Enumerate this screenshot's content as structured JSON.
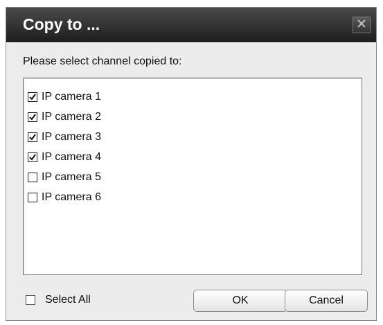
{
  "dialog": {
    "title": "Copy to ...",
    "prompt": "Please select channel copied to:",
    "close_icon": "close-icon"
  },
  "channels": [
    {
      "label": "IP camera 1",
      "checked": true
    },
    {
      "label": "IP camera 2",
      "checked": true
    },
    {
      "label": "IP camera 3",
      "checked": true
    },
    {
      "label": "IP camera 4",
      "checked": true
    },
    {
      "label": "IP camera 5",
      "checked": false
    },
    {
      "label": "IP camera 6",
      "checked": false
    }
  ],
  "footer": {
    "select_all_label": "Select All",
    "select_all_checked": false,
    "ok_label": "OK",
    "cancel_label": "Cancel"
  }
}
